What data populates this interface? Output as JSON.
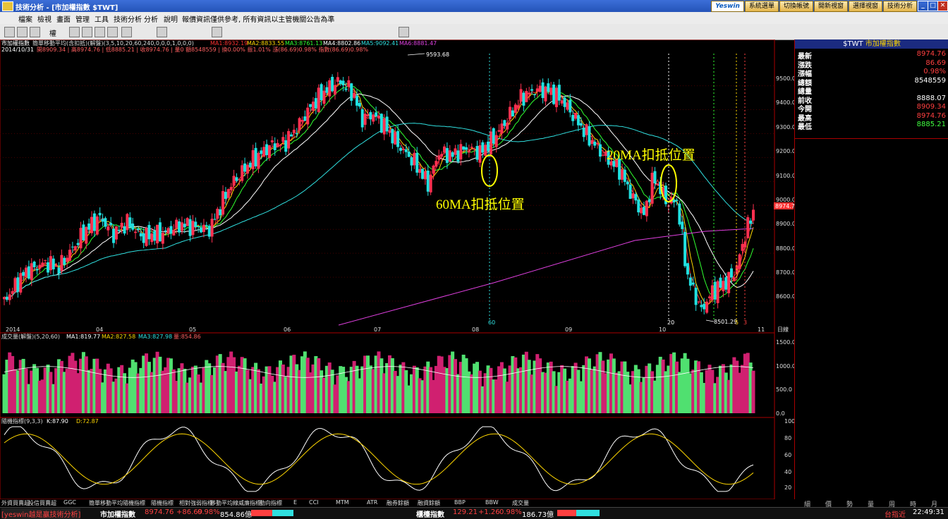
{
  "window": {
    "title": "技術分析 - [市加權指數 $TWT]",
    "buttons": [
      "系統選單",
      "切換帳號",
      "開新視窗",
      "選擇視窗",
      "技術分析"
    ],
    "brand": "Yeswin",
    "controls": [
      "_",
      "□",
      "✕"
    ]
  },
  "menu": [
    "檔案",
    "檢視",
    "畫面",
    "管理",
    "工具",
    "技術分析",
    "分析",
    "說明",
    "報價資訊僅供參考, 所有資訊以主管機關公告為準"
  ],
  "toolbar": {
    "icons": [
      "new-icon",
      "open-icon",
      "bar-style-icon",
      "candle-style-icon",
      "zoom-in-icon",
      "zoom-out-icon",
      "crosshair-icon",
      "draw-line-icon",
      "draw-rect-icon",
      "text-icon",
      "save-icon"
    ],
    "period_label": "權"
  },
  "price_panel": {
    "header_name": "市加權指數",
    "indicator_line": "簡單移動平均(含扣抵)(解盤)(3,5,10,20,60,240,0,0,0,1,0,0,0)",
    "ma_values": [
      {
        "label": "MA1:8932.19",
        "color": "#ff3030"
      },
      {
        "label": "MA2:8833.55",
        "color": "#ffd700"
      },
      {
        "label": "MA3:8761.13",
        "color": "#30ff30"
      },
      {
        "label": "MA4:8802.86",
        "color": "#ffffff"
      },
      {
        "label": "MA5:9092.41",
        "color": "#30e0e0"
      },
      {
        "label": "MA6:8881.47",
        "color": "#e040e0"
      }
    ],
    "date_line": "2014/10/31",
    "ohlc_line": "開8909.34 | 高8974.76 | 低8885.21 | 收8974.76 | 量0 額8548559 | 換0.00% 振1.01% 漲(86.69)0.98% 指數(86.69)0.98%",
    "high_label": "9593.68",
    "low_label": "8501.29",
    "last_price_tag": "8974.76",
    "y_ticks": [
      "9500.0",
      "9400.0",
      "9300.0",
      "9200.0",
      "9100.0",
      "9000.0",
      "8900.0",
      "8800.0",
      "8700.0",
      "8600.0"
    ],
    "x_ticks": [
      "2014",
      "04",
      "05",
      "06",
      "07",
      "08",
      "09",
      "10",
      "11"
    ],
    "x_unit": "日線",
    "annotation_60ma": "60MA扣抵位置",
    "annotation_20ma": "20MA扣抵位置",
    "marker_60": "60",
    "marker_20": "20",
    "marker_5": "5",
    "marker_3": "3"
  },
  "volume_panel": {
    "title": "成交量(解盤)(5,20,60)",
    "ma1": "MA1:819.77",
    "ma2": "MA2:827.58",
    "ma3": "MA3:827.98",
    "vol": "量:854.86",
    "y_ticks": [
      "1500.0",
      "1000.0",
      "500.0",
      "0.0"
    ]
  },
  "kd_panel": {
    "title": "隨機指標(9,3,3)",
    "k": "K:87.90",
    "d": "D:72.87",
    "y_ticks": [
      "100",
      "80",
      "60",
      "40",
      "20"
    ]
  },
  "quote_panel": {
    "header_code": "$TWT",
    "header_name": "市加權指數",
    "rows": [
      {
        "label": "最新",
        "value": "8974.76",
        "color": "#ff4040"
      },
      {
        "label": "漲跌",
        "value": "86.69",
        "color": "#ff4040"
      },
      {
        "label": "漲幅",
        "value": "0.98%",
        "color": "#ff4040"
      },
      {
        "label": "總額",
        "value": "8548559",
        "color": "#ffffff"
      },
      {
        "label": "總量",
        "value": "",
        "color": "#ffffff"
      },
      {
        "label": "前收",
        "value": "8888.07",
        "color": "#ffffff"
      },
      {
        "label": "今開",
        "value": "8909.34",
        "color": "#ff4040"
      },
      {
        "label": "最高",
        "value": "8974.76",
        "color": "#ff4040"
      },
      {
        "label": "最低",
        "value": "8885.21",
        "color": "#40ff40"
      }
    ]
  },
  "indicator_tabs": [
    "外資買賣超",
    "投信買賣超",
    "GGC",
    "簡單移動平均",
    "隨機指標",
    "隨機指標",
    "相對強弱指標",
    "移動平均線",
    "威廉指標",
    "動向指標",
    "E",
    "CCI",
    "MTM",
    "ATR",
    "融券餘額",
    "融資餘額",
    "BBP",
    "BBW",
    "成交量"
  ],
  "right_tabs": [
    "細",
    "價",
    "勢",
    "量",
    "周",
    "時",
    "月"
  ],
  "statusbar": {
    "left_brand": "[yeswin越是贏技術分析]",
    "index1_name": "市加權指數",
    "index1_value": "8974.76",
    "index1_change": "+86.69",
    "index1_pct": "0.98%",
    "index1_amt": "854.86億",
    "index2_name": "櫃檯指數",
    "index2_value": "129.21",
    "index2_change": "+1.26",
    "index2_pct": "0.98%",
    "index2_amt": "186.73億",
    "right_label": "台指近",
    "time": "22:49:31"
  },
  "chart_data": {
    "type": "candlestick",
    "x_range": [
      "2014-01",
      "2014-11"
    ],
    "ylim": [
      8500,
      9600
    ],
    "high": 9593.68,
    "low": 8501.29,
    "last": 8974.76
  }
}
